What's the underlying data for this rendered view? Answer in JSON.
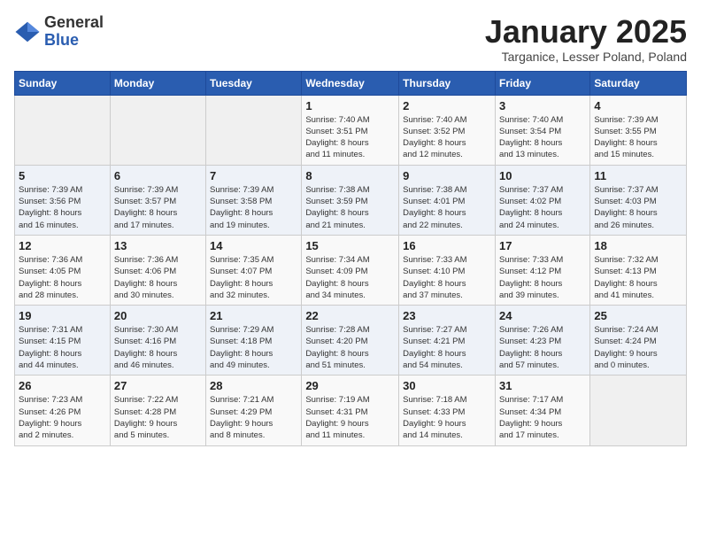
{
  "logo": {
    "general": "General",
    "blue": "Blue"
  },
  "title": "January 2025",
  "subtitle": "Targanice, Lesser Poland, Poland",
  "days_header": [
    "Sunday",
    "Monday",
    "Tuesday",
    "Wednesday",
    "Thursday",
    "Friday",
    "Saturday"
  ],
  "weeks": [
    [
      {
        "day": "",
        "info": ""
      },
      {
        "day": "",
        "info": ""
      },
      {
        "day": "",
        "info": ""
      },
      {
        "day": "1",
        "info": "Sunrise: 7:40 AM\nSunset: 3:51 PM\nDaylight: 8 hours\nand 11 minutes."
      },
      {
        "day": "2",
        "info": "Sunrise: 7:40 AM\nSunset: 3:52 PM\nDaylight: 8 hours\nand 12 minutes."
      },
      {
        "day": "3",
        "info": "Sunrise: 7:40 AM\nSunset: 3:54 PM\nDaylight: 8 hours\nand 13 minutes."
      },
      {
        "day": "4",
        "info": "Sunrise: 7:39 AM\nSunset: 3:55 PM\nDaylight: 8 hours\nand 15 minutes."
      }
    ],
    [
      {
        "day": "5",
        "info": "Sunrise: 7:39 AM\nSunset: 3:56 PM\nDaylight: 8 hours\nand 16 minutes."
      },
      {
        "day": "6",
        "info": "Sunrise: 7:39 AM\nSunset: 3:57 PM\nDaylight: 8 hours\nand 17 minutes."
      },
      {
        "day": "7",
        "info": "Sunrise: 7:39 AM\nSunset: 3:58 PM\nDaylight: 8 hours\nand 19 minutes."
      },
      {
        "day": "8",
        "info": "Sunrise: 7:38 AM\nSunset: 3:59 PM\nDaylight: 8 hours\nand 21 minutes."
      },
      {
        "day": "9",
        "info": "Sunrise: 7:38 AM\nSunset: 4:01 PM\nDaylight: 8 hours\nand 22 minutes."
      },
      {
        "day": "10",
        "info": "Sunrise: 7:37 AM\nSunset: 4:02 PM\nDaylight: 8 hours\nand 24 minutes."
      },
      {
        "day": "11",
        "info": "Sunrise: 7:37 AM\nSunset: 4:03 PM\nDaylight: 8 hours\nand 26 minutes."
      }
    ],
    [
      {
        "day": "12",
        "info": "Sunrise: 7:36 AM\nSunset: 4:05 PM\nDaylight: 8 hours\nand 28 minutes."
      },
      {
        "day": "13",
        "info": "Sunrise: 7:36 AM\nSunset: 4:06 PM\nDaylight: 8 hours\nand 30 minutes."
      },
      {
        "day": "14",
        "info": "Sunrise: 7:35 AM\nSunset: 4:07 PM\nDaylight: 8 hours\nand 32 minutes."
      },
      {
        "day": "15",
        "info": "Sunrise: 7:34 AM\nSunset: 4:09 PM\nDaylight: 8 hours\nand 34 minutes."
      },
      {
        "day": "16",
        "info": "Sunrise: 7:33 AM\nSunset: 4:10 PM\nDaylight: 8 hours\nand 37 minutes."
      },
      {
        "day": "17",
        "info": "Sunrise: 7:33 AM\nSunset: 4:12 PM\nDaylight: 8 hours\nand 39 minutes."
      },
      {
        "day": "18",
        "info": "Sunrise: 7:32 AM\nSunset: 4:13 PM\nDaylight: 8 hours\nand 41 minutes."
      }
    ],
    [
      {
        "day": "19",
        "info": "Sunrise: 7:31 AM\nSunset: 4:15 PM\nDaylight: 8 hours\nand 44 minutes."
      },
      {
        "day": "20",
        "info": "Sunrise: 7:30 AM\nSunset: 4:16 PM\nDaylight: 8 hours\nand 46 minutes."
      },
      {
        "day": "21",
        "info": "Sunrise: 7:29 AM\nSunset: 4:18 PM\nDaylight: 8 hours\nand 49 minutes."
      },
      {
        "day": "22",
        "info": "Sunrise: 7:28 AM\nSunset: 4:20 PM\nDaylight: 8 hours\nand 51 minutes."
      },
      {
        "day": "23",
        "info": "Sunrise: 7:27 AM\nSunset: 4:21 PM\nDaylight: 8 hours\nand 54 minutes."
      },
      {
        "day": "24",
        "info": "Sunrise: 7:26 AM\nSunset: 4:23 PM\nDaylight: 8 hours\nand 57 minutes."
      },
      {
        "day": "25",
        "info": "Sunrise: 7:24 AM\nSunset: 4:24 PM\nDaylight: 9 hours\nand 0 minutes."
      }
    ],
    [
      {
        "day": "26",
        "info": "Sunrise: 7:23 AM\nSunset: 4:26 PM\nDaylight: 9 hours\nand 2 minutes."
      },
      {
        "day": "27",
        "info": "Sunrise: 7:22 AM\nSunset: 4:28 PM\nDaylight: 9 hours\nand 5 minutes."
      },
      {
        "day": "28",
        "info": "Sunrise: 7:21 AM\nSunset: 4:29 PM\nDaylight: 9 hours\nand 8 minutes."
      },
      {
        "day": "29",
        "info": "Sunrise: 7:19 AM\nSunset: 4:31 PM\nDaylight: 9 hours\nand 11 minutes."
      },
      {
        "day": "30",
        "info": "Sunrise: 7:18 AM\nSunset: 4:33 PM\nDaylight: 9 hours\nand 14 minutes."
      },
      {
        "day": "31",
        "info": "Sunrise: 7:17 AM\nSunset: 4:34 PM\nDaylight: 9 hours\nand 17 minutes."
      },
      {
        "day": "",
        "info": ""
      }
    ]
  ]
}
